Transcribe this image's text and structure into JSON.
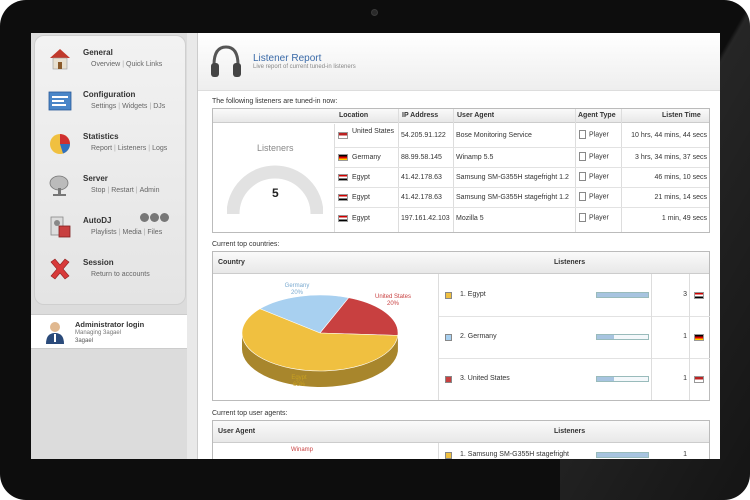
{
  "sidebar": {
    "items": [
      {
        "title": "General",
        "links": [
          "Overview",
          "Quick Links"
        ],
        "icon": "home-icon"
      },
      {
        "title": "Configuration",
        "links": [
          "Settings",
          "Widgets",
          "DJs"
        ],
        "icon": "settings-panel-icon"
      },
      {
        "title": "Statistics",
        "links": [
          "Report",
          "Listeners",
          "Logs"
        ],
        "icon": "pie-chart-icon"
      },
      {
        "title": "Server",
        "links": [
          "Stop",
          "Restart",
          "Admin"
        ],
        "icon": "satellite-dish-icon"
      },
      {
        "title": "AutoDJ",
        "links": [
          "Playlists",
          "Media",
          "Files"
        ],
        "icon": "dj-icon"
      },
      {
        "title": "Session",
        "links": [
          "Return to accounts"
        ],
        "icon": "close-x-icon"
      }
    ],
    "admin": {
      "title": "Administrator login",
      "subtitle": "Managing 3agael",
      "user": "3agael"
    }
  },
  "header": {
    "title": "Listener Report",
    "subtitle": "Live report of current tuned-in listeners"
  },
  "listeners": {
    "label": "The following listeners are tuned-in now:",
    "gauge_label": "Listeners",
    "count": "5",
    "columns": [
      "Location",
      "IP Address",
      "User Agent",
      "Agent Type",
      "Listen Time"
    ],
    "rows": [
      {
        "location": "United States",
        "ip": "54.205.91.122",
        "agent": "Bose Monitoring Service",
        "type": "Player",
        "time": "10 hrs, 44 mins, 44 secs",
        "flag": "us"
      },
      {
        "location": "Germany",
        "ip": "88.99.58.145",
        "agent": "Winamp 5.5",
        "type": "Player",
        "time": "3 hrs, 34 mins, 37 secs",
        "flag": "de"
      },
      {
        "location": "Egypt",
        "ip": "41.42.178.63",
        "agent": "Samsung SM-G355H stagefright 1.2",
        "type": "Player",
        "time": "46 mins, 10 secs",
        "flag": "eg"
      },
      {
        "location": "Egypt",
        "ip": "41.42.178.63",
        "agent": "Samsung SM-G355H stagefright 1.2",
        "type": "Player",
        "time": "21 mins, 14 secs",
        "flag": "eg"
      },
      {
        "location": "Egypt",
        "ip": "197.161.42.103",
        "agent": "Mozilla 5",
        "type": "Player",
        "time": "1 min, 49 secs",
        "flag": "eg"
      }
    ]
  },
  "countries": {
    "label": "Current top countries:",
    "col_country": "Country",
    "col_listeners": "Listeners",
    "pie_labels": [
      {
        "name": "Germany",
        "pct": "20%"
      },
      {
        "name": "United States",
        "pct": "20%"
      },
      {
        "name": "Egypt",
        "pct": "60%"
      }
    ],
    "rows": [
      {
        "name": "1. Egypt",
        "count": "3",
        "fraction": 1.0,
        "color": "#f0c040",
        "flag": "eg"
      },
      {
        "name": "2. Germany",
        "count": "1",
        "fraction": 0.33,
        "color": "#a8d0f0",
        "flag": "de"
      },
      {
        "name": "3. United States",
        "count": "1",
        "fraction": 0.33,
        "color": "#c84040",
        "flag": "us"
      }
    ]
  },
  "agents": {
    "label": "Current top user agents:",
    "col_agent": "User Agent",
    "col_listeners": "Listeners",
    "pie_label": "Winamp",
    "row": {
      "name": "1. Samsung SM-G355H stagefright",
      "count": "1"
    }
  },
  "chart_data": {
    "type": "pie",
    "categories": [
      "Egypt",
      "Germany",
      "United States"
    ],
    "values": [
      60,
      20,
      20
    ],
    "colors": [
      "#f0c040",
      "#a8d0f0",
      "#c84040"
    ]
  }
}
